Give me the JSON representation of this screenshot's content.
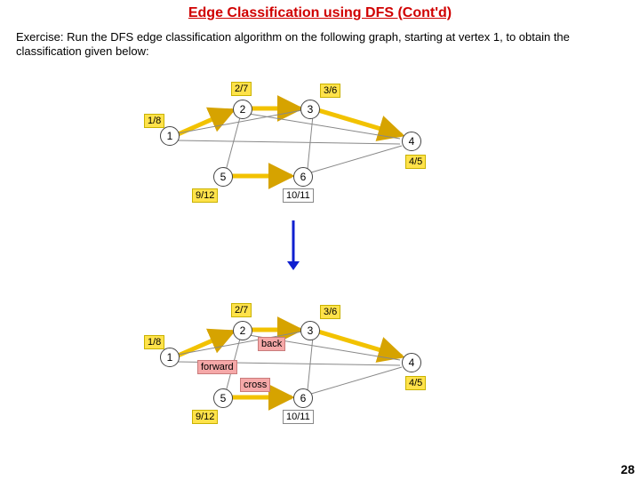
{
  "title": "Edge Classification using DFS (Cont'd)",
  "exercise": "Exercise: Run the DFS edge classification algorithm on the following graph, starting at vertex 1, to obtain the classification given below:",
  "page_number": "28",
  "graph_nodes": {
    "n1": "1",
    "n2": "2",
    "n3": "3",
    "n4": "4",
    "n5": "5",
    "n6": "6"
  },
  "dfs_times": {
    "v1": "1/8",
    "v2": "2/7",
    "v3": "3/6",
    "v4": "4/5",
    "v5": "9/12",
    "v6": "10/11"
  },
  "edge_labels": {
    "back": "back",
    "forward": "forward",
    "cross": "cross"
  },
  "chart_data": {
    "type": "graph",
    "vertices": [
      1,
      2,
      3,
      4,
      5,
      6
    ],
    "edges": [
      {
        "from": 1,
        "to": 2,
        "class": "tree"
      },
      {
        "from": 2,
        "to": 3,
        "class": "tree"
      },
      {
        "from": 3,
        "to": 4,
        "class": "tree"
      },
      {
        "from": 2,
        "to": 4,
        "class": "forward"
      },
      {
        "from": 1,
        "to": 4,
        "class": "forward"
      },
      {
        "from": 3,
        "to": 1,
        "class": "back"
      },
      {
        "from": 5,
        "to": 6,
        "class": "tree"
      },
      {
        "from": 5,
        "to": 2,
        "class": "cross"
      },
      {
        "from": 6,
        "to": 3,
        "class": "cross"
      },
      {
        "from": 6,
        "to": 4,
        "class": "cross"
      }
    ],
    "discovery_finish": {
      "1": [
        1,
        8
      ],
      "2": [
        2,
        7
      ],
      "3": [
        3,
        6
      ],
      "4": [
        4,
        5
      ],
      "5": [
        9,
        12
      ],
      "6": [
        10,
        11
      ]
    }
  }
}
